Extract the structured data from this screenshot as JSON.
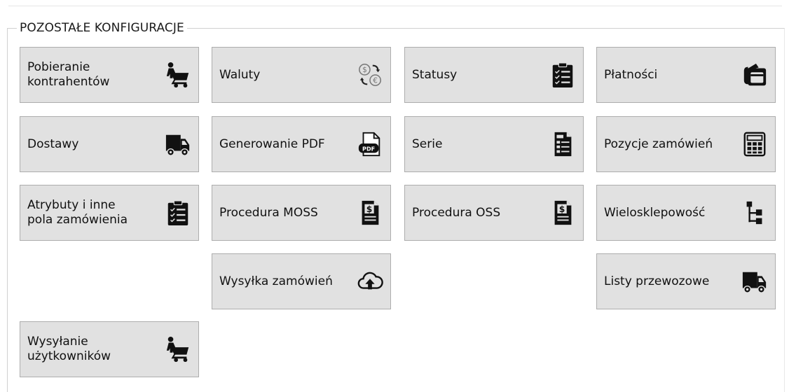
{
  "group": {
    "title": "POZOSTAŁE KONFIGURACJE"
  },
  "tiles": [
    {
      "label": "Pobieranie\nkontrahentów",
      "icon": "shopping-cart-person-icon"
    },
    {
      "label": "Waluty",
      "icon": "currency-exchange-icon"
    },
    {
      "label": "Statusy",
      "icon": "clipboard-checklist-icon"
    },
    {
      "label": "Płatności",
      "icon": "wallet-icon"
    },
    {
      "label": "Dostawy",
      "icon": "delivery-truck-icon"
    },
    {
      "label": "Generowanie PDF",
      "icon": "pdf-file-icon"
    },
    {
      "label": "Serie",
      "icon": "document-series-icon"
    },
    {
      "label": "Pozycje zamówień",
      "icon": "calculator-icon"
    },
    {
      "label": "Atrybuty i inne\npola zamówienia",
      "icon": "clipboard-checklist-icon"
    },
    {
      "label": "Procedura MOSS",
      "icon": "dollar-document-icon"
    },
    {
      "label": "Procedura OSS",
      "icon": "dollar-document-icon"
    },
    {
      "label": "Wielosklepowość",
      "icon": "hierarchy-tree-icon"
    },
    {
      "label": "Wysyłka zamówień",
      "icon": "cloud-upload-icon"
    },
    {
      "label": "Listy przewozowe",
      "icon": "delivery-truck-icon"
    },
    {
      "label": "Wysyłanie\nużytkowników",
      "icon": "shopping-cart-person-icon"
    }
  ]
}
